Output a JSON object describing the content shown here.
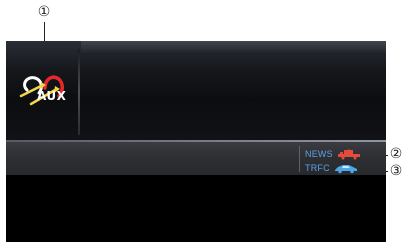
{
  "callouts": {
    "one": "①",
    "two": "②",
    "three": "③"
  },
  "source": {
    "label": "AUX",
    "icon": "aux-source-icon"
  },
  "indicators": {
    "news": {
      "label": "NEWS",
      "icon": "news-truck-icon",
      "color": "#e64a3a"
    },
    "traffic": {
      "label": "TRFC",
      "icon": "traffic-car-icon",
      "color": "#4aa8e8"
    }
  },
  "colors": {
    "indicator_text": "#5aa0e8",
    "background": "#000000"
  }
}
